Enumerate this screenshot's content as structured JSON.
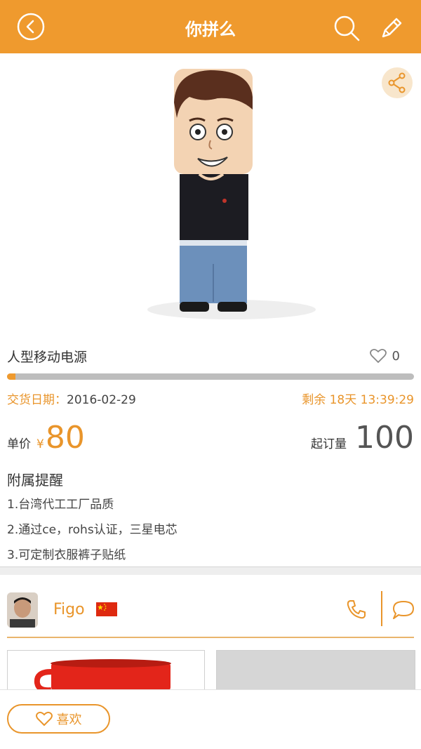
{
  "header": {
    "title": "你拼么"
  },
  "product": {
    "title": "人型移动电源",
    "like_count": "0",
    "progress": 0.02,
    "delivery_label": "交货日期：",
    "delivery_date": "2016-02-29",
    "remaining": "剩余 18天 13:39:29",
    "price_label": "单价",
    "price_currency": "¥",
    "price_value": "80",
    "moq_label": "起订量",
    "moq_value": "100"
  },
  "notes": {
    "title": "附属提醒",
    "items": [
      "1.台湾代工工厂品质",
      "2.通过ce，rohs认证，三星电芯",
      "3.可定制衣服裤子贴纸"
    ]
  },
  "seller": {
    "name": "Figo"
  },
  "bottom": {
    "favorite_label": "喜欢"
  },
  "colors": {
    "accent": "#ef9a2e",
    "accent_text": "#e9952b"
  }
}
